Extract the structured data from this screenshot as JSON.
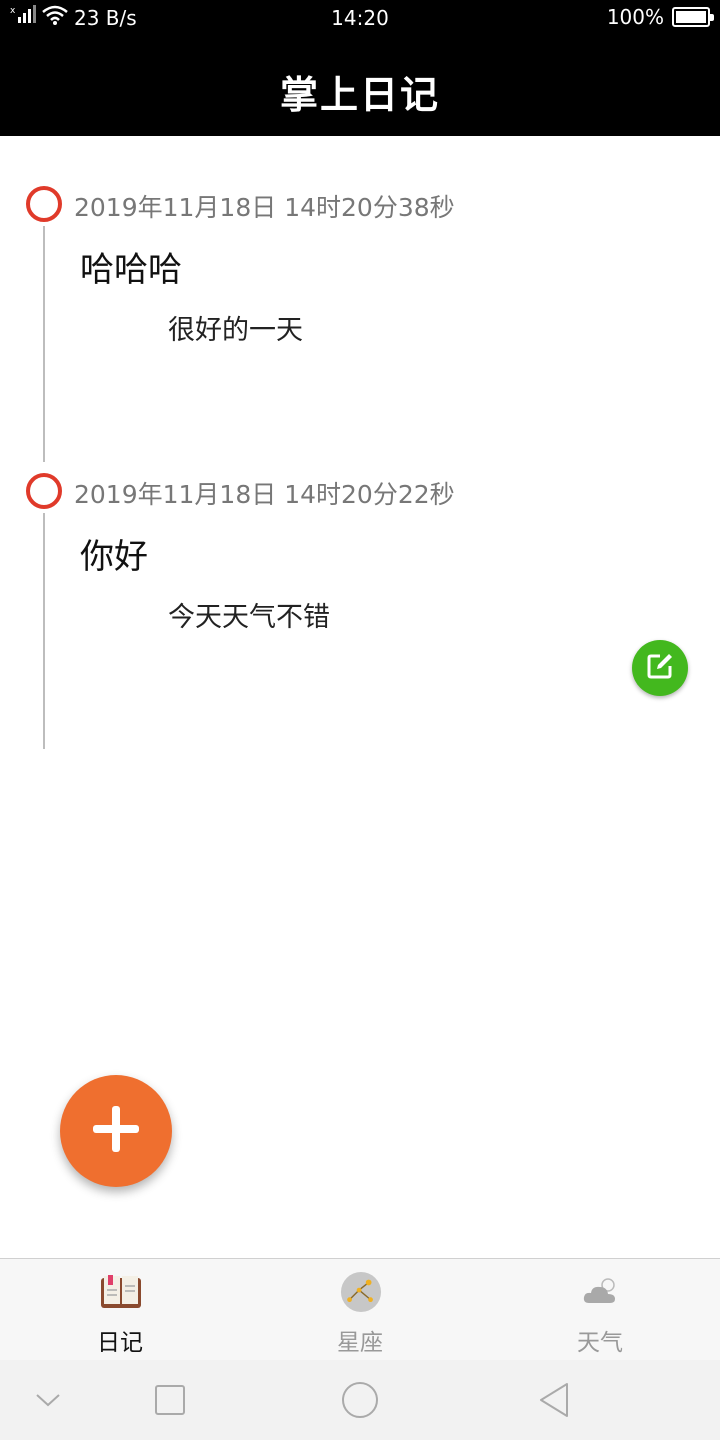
{
  "status_bar": {
    "net_speed": "23 B/s",
    "time": "14:20",
    "battery": "100%",
    "battery_level": 1.0
  },
  "header": {
    "title": "掌上日记"
  },
  "entries": [
    {
      "date": "2019年11月18日 14时20分38秒",
      "title": "哈哈哈",
      "body": "很好的一天"
    },
    {
      "date": "2019年11月18日 14时20分22秒",
      "title": "你好",
      "body": "今天天气不错"
    }
  ],
  "bottom_nav": {
    "items": [
      {
        "label": "日记",
        "icon": "diary-book-icon",
        "active": true
      },
      {
        "label": "星座",
        "icon": "constellation-icon",
        "active": false
      },
      {
        "label": "天气",
        "icon": "weather-cloud-icon",
        "active": false
      }
    ]
  },
  "colors": {
    "header_bg": "#000000",
    "timeline_dot": "#e03a2a",
    "fab": "#ef6f2f",
    "edit_button": "#43b81e"
  }
}
